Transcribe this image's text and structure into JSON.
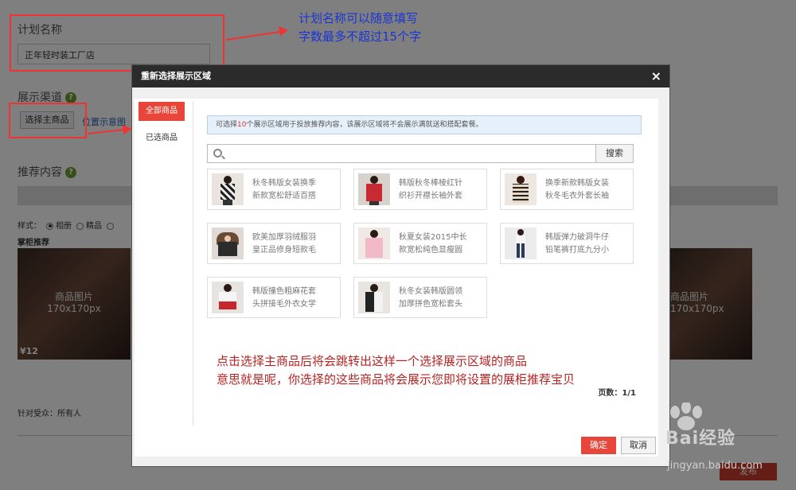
{
  "plan": {
    "label": "计划名称",
    "value": "正年轻时装工厂店"
  },
  "channel": {
    "label": "展示渠道",
    "select_button": "选择主商品",
    "position_link": "位置示意图"
  },
  "recommend": {
    "label": "推荐内容",
    "style_label": "样式：",
    "style_options": [
      "相册",
      "精品"
    ],
    "shop_title": "掌柜推荐",
    "image_caption_1": "商品图片",
    "image_caption_2": "170x170px",
    "price": "¥12"
  },
  "audience": "针对受众：所有人",
  "publish_button": "发布",
  "annotations": {
    "blue_line1": "计划名称可以随意填写",
    "blue_line2": "字数最多不超过15个字",
    "red_line1": "点击选择主商品后将会跳转出这样一个选择展示区域的商品",
    "red_line2": "意思就是呢，你选择的这些商品将会展示您即将设置的展柜推荐宝贝"
  },
  "modal": {
    "title": "重新选择展示区域",
    "close": "×",
    "tab_all": "全部商品",
    "tab_selected": "已选商品",
    "info_prefix": "可选择",
    "info_count": "10",
    "info_suffix": "个展示区域用于投放推荐内容，该展示区域将不会展示满就送和搭配套餐。",
    "search_placeholder": "",
    "search_button": "搜索",
    "products": [
      {
        "line1": "秋冬韩版女装换季",
        "line2": "新款宽松舒适百搭"
      },
      {
        "line1": "韩版秋冬棒棱红针",
        "line2": "织衫开襟长袖外套"
      },
      {
        "line1": "换季新款韩版女装",
        "line2": "秋冬毛衣外套长袖"
      },
      {
        "line1": "欧美加厚羽绒服羽",
        "line2": "皇正品修身短款毛"
      },
      {
        "line1": "秋夏女装2015中长",
        "line2": "款宽松纯色显瘦圆"
      },
      {
        "line1": "韩版弹力破洞牛仔",
        "line2": "铅笔裤打底九分小"
      },
      {
        "line1": "韩版撞色粗麻花套",
        "line2": "头拼接毛外衣女学"
      },
      {
        "line1": "秋冬女装韩版圆领",
        "line2": "加厚拼色宽松套头"
      }
    ],
    "pager": "页数：1/1",
    "confirm": "确定",
    "cancel": "取消"
  },
  "watermark": {
    "brand": "Bai经验",
    "url": "jingyan.baidu.com"
  }
}
